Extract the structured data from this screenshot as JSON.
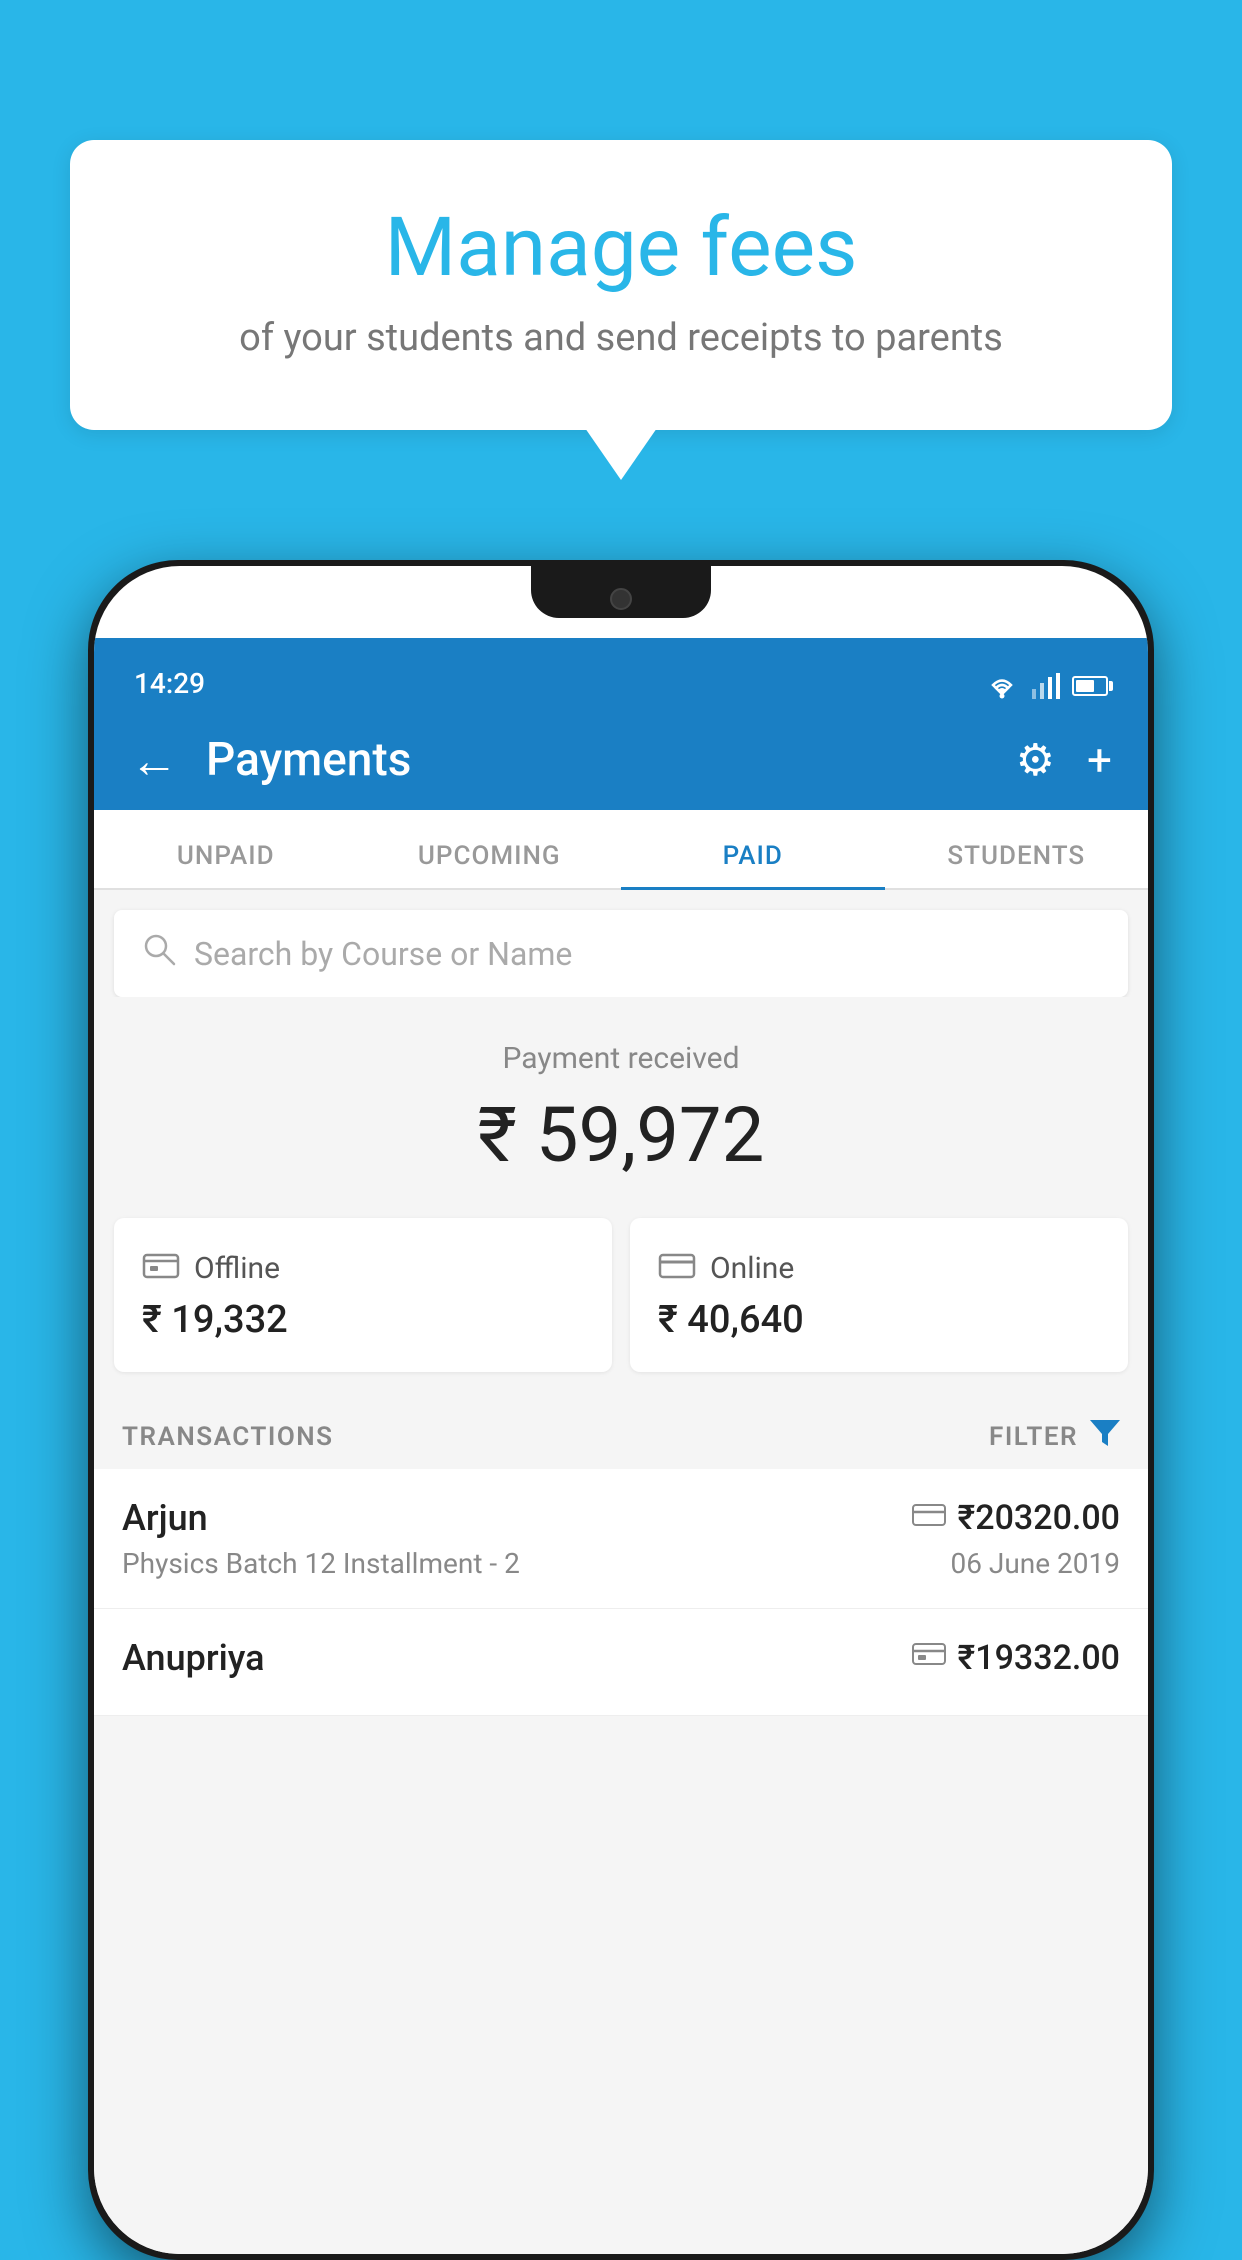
{
  "background_color": "#29B6E8",
  "speech_bubble": {
    "title": "Manage fees",
    "subtitle": "of your students and send receipts to parents"
  },
  "status_bar": {
    "time": "14:29"
  },
  "header": {
    "title": "Payments",
    "back_label": "←",
    "gear_label": "⚙",
    "plus_label": "+"
  },
  "tabs": [
    {
      "id": "unpaid",
      "label": "UNPAID",
      "active": false
    },
    {
      "id": "upcoming",
      "label": "UPCOMING",
      "active": false
    },
    {
      "id": "paid",
      "label": "PAID",
      "active": true
    },
    {
      "id": "students",
      "label": "STUDENTS",
      "active": false
    }
  ],
  "search": {
    "placeholder": "Search by Course or Name"
  },
  "payment": {
    "label": "Payment received",
    "amount": "₹ 59,972",
    "offline": {
      "label": "Offline",
      "amount": "₹ 19,332"
    },
    "online": {
      "label": "Online",
      "amount": "₹ 40,640"
    }
  },
  "transactions": {
    "header": "TRANSACTIONS",
    "filter_label": "FILTER",
    "items": [
      {
        "name": "Arjun",
        "description": "Physics Batch 12 Installment - 2",
        "amount": "₹20320.00",
        "date": "06 June 2019",
        "icon_type": "card"
      },
      {
        "name": "Anupriya",
        "description": "",
        "amount": "₹19332.00",
        "date": "",
        "icon_type": "offline"
      }
    ]
  }
}
